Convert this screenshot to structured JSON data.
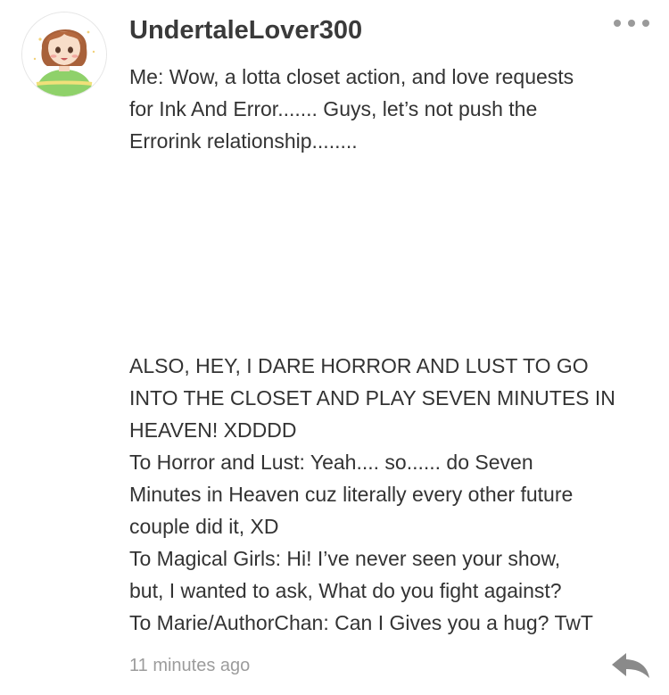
{
  "comment": {
    "avatar_icon": "user-avatar",
    "username": "UndertaleLover300",
    "more_icon": "more-dots-icon",
    "paragraph1": [
      "Me: Wow, a lotta closet action, and love requests",
      "for Ink And Error....... Guys, let’s not push the",
      "Errorink relationship........"
    ],
    "paragraph2": [
      "ALSO, HEY, I DARE HORROR AND LUST TO GO",
      "INTO THE CLOSET AND PLAY SEVEN MINUTES IN",
      "HEAVEN! XDDDD",
      "To Horror and Lust: Yeah.... so...... do Seven",
      "Minutes in Heaven cuz literally every other future",
      "couple did it, XD",
      "To Magical Girls: Hi! I’ve never seen your show,",
      "but, I wanted to ask, What do you fight against?",
      "To Marie/AuthorChan: Can I Gives you a hug? TwT"
    ],
    "timestamp": "11 minutes ago",
    "reply_icon": "reply-arrow-icon",
    "colors": {
      "text": "#333333",
      "muted": "#9c9c9c"
    }
  }
}
